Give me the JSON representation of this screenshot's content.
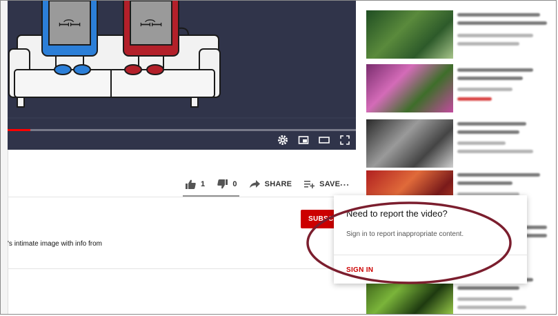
{
  "player": {
    "progress_fraction": 0.065,
    "controls": [
      "settings-icon",
      "miniplayer-icon",
      "theater-mode-icon",
      "fullscreen-icon"
    ]
  },
  "actions": {
    "like_count": "1",
    "dislike_count": "0",
    "share_label": "SHARE",
    "save_label": "SAVE",
    "more_label": "..."
  },
  "subscribe": {
    "label": "SUBSCR"
  },
  "description": {
    "snippet": "'s intimate image with info from"
  },
  "report_popup": {
    "title": "Need to report the video?",
    "body": "Sign in to report inappropriate content.",
    "sign_in_label": "SIGN IN"
  },
  "colors": {
    "accent_red": "#cc0000",
    "highlight_ellipse": "#7b1e2e",
    "player_bg": "#30344a"
  }
}
